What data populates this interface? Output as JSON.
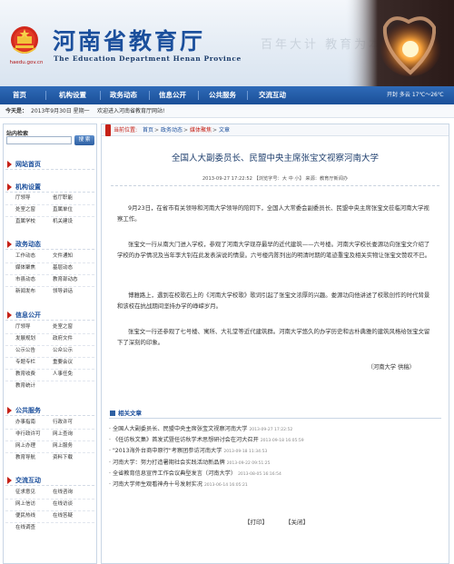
{
  "header": {
    "title_cn": "河南省教育厅",
    "title_en": "The Education Department Henan Province",
    "site_url": "haedu.gov.cn",
    "slogan": "百年大计 教育为本"
  },
  "nav": {
    "items": [
      "首页",
      "机构设置",
      "政务动态",
      "信息公开",
      "公共服务",
      "交流互动"
    ],
    "status": "开封  多云  17℃～26℃"
  },
  "datebar": {
    "label": "今天是：",
    "date": "2013年9月30日 星期一",
    "welcome": "欢迎进入河南省教育厅网站!"
  },
  "sidebar": {
    "search_title": "站内检索",
    "search_button": "搜 索",
    "home": "网站首页",
    "sections": [
      {
        "title": "机构设置",
        "items": [
          "厅领导",
          "省厅职能",
          "处室之窗",
          "直属单位",
          "直属学校",
          "机关建设"
        ]
      },
      {
        "title": "政务动态",
        "items": [
          "工作动态",
          "文件通知",
          "媒体聚焦",
          "基层动态",
          "市县动态",
          "教育部动态",
          "新闻发布",
          "领导讲话"
        ]
      },
      {
        "title": "信息公开",
        "items": [
          "厅领导",
          "处室之窗",
          "发展规划",
          "政府文件",
          "公示公告",
          "公众公示",
          "专题专栏",
          "重要会议",
          "教育收费",
          "人事任免",
          "教育统计"
        ]
      },
      {
        "title": "公共服务",
        "items": [
          "办事指南",
          "行政许可",
          "非行政许可",
          "网上查询",
          "网上办理",
          "网上服务",
          "教育导航",
          "资料下载"
        ]
      },
      {
        "title": "交流互动",
        "items": [
          "征求意见",
          "在线咨询",
          "网上信访",
          "在线访谈",
          "便民热线",
          "在线答疑",
          "在线调查"
        ]
      }
    ]
  },
  "breadcrumb": {
    "prefix": "当前位置:",
    "items": [
      "首页",
      "政务动态",
      "媒体聚焦",
      "文章"
    ],
    "separator": ">"
  },
  "article": {
    "title": "全国人大副委员长、民盟中央主席张宝文视察河南大学",
    "meta": "2013-09-27  17:22:52  【浏览字号：大  中  小】  来源：教育厅新闻办",
    "paragraphs": [
      "9月23日，在省市有关领导和河南大学领导的陪同下，全国人大常委会副委员长、民盟中央主席张宝文莅临河南大学视察工作。",
      "张宝文一行从南大门进入学校，参观了河南大学现存最早的近代建筑——六号楼。河南大学校长娄源功向张宝文介绍了学校的办学情况及当年李大钊在此发表演说的情景。六号楼内陈列出的明清时期的笔迹重宝及相关实物让张宝文赞叹不已。",
      "博雅路上，遇到在校歌石上的《河南大学校歌》歌词引起了张宝文浓厚的兴趣。娄源功向他讲述了校歌创作的时代背景和该校在抗战期间坚持办学的峥嵘岁月。",
      "张宝文一行还参观了七号楼、寓所、大礼堂等近代建筑群。河南大学悠久的办学历史和古朴典雅的建筑风格给张宝文留下了深刻的印象。"
    ],
    "source": "（河南大学  供稿）"
  },
  "related": {
    "title": "相关文章",
    "items": [
      {
        "text": "全国人大副委员长、民盟中央主席张宝文视察河南大学",
        "date": "2013-09-27 17:22:52"
      },
      {
        "text": "《任访秋文集》首发式暨任访秋学术思想研讨会在河大召开",
        "date": "2013-09-18 16:05:59"
      },
      {
        "text": "\"2013海外台商中原行\"考察团参访河南大学",
        "date": "2013-09-18 11:34:53"
      },
      {
        "text": "河南大学：努力打造暑期社会实践活动新品牌",
        "date": "2013-09-22 09:51:25"
      },
      {
        "text": "全省教育信息宣传工作会议典型发言（河南大学）",
        "date": "2013-08-05 16:16:54"
      },
      {
        "text": "河南大学师生观看神舟十号发射实况",
        "date": "2013-06-14 16:05:21"
      }
    ]
  },
  "actions": {
    "print": "【打印】",
    "close": "【关闭】"
  },
  "colors": {
    "brand_blue": "#1b4f9c",
    "nav_blue": "#1b4f98",
    "accent_red": "#c62117"
  }
}
